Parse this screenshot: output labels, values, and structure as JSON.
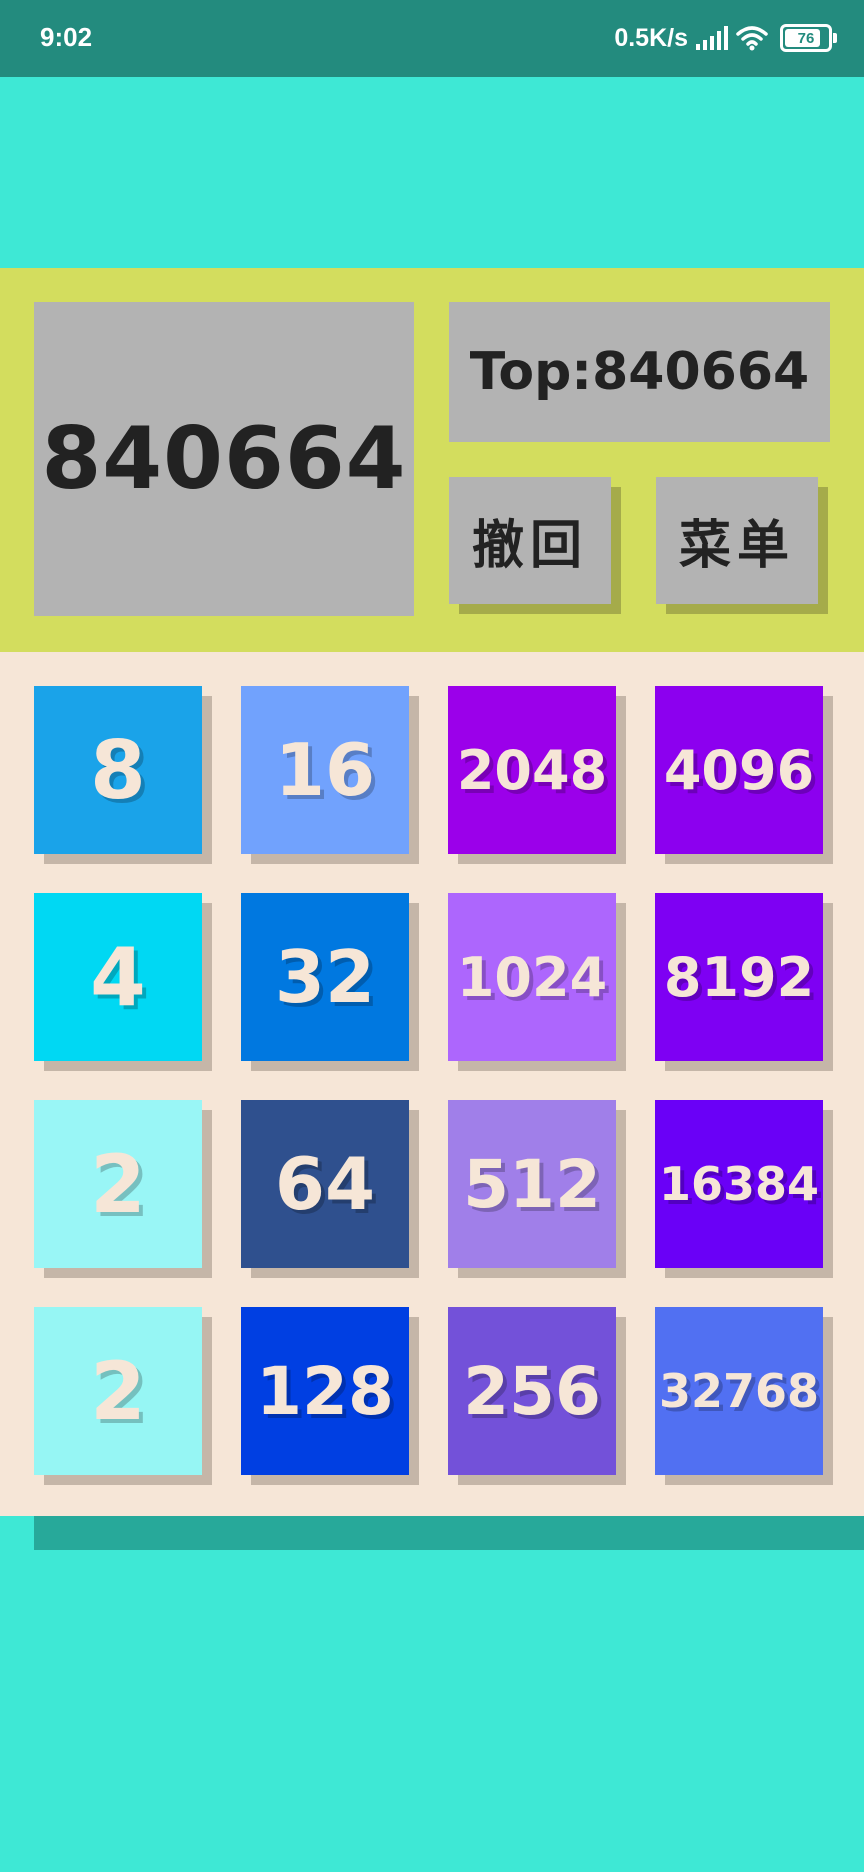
{
  "status_bar": {
    "time": "9:02",
    "net_speed": "0.5K/s",
    "battery_level": "76"
  },
  "header": {
    "score": "840664",
    "top": "Top:840664",
    "undo_label": "撤回",
    "menu_label": "菜单"
  },
  "board": {
    "tiles": [
      {
        "value": "8",
        "color": "#1aa3e9"
      },
      {
        "value": "16",
        "color": "#71a2fd"
      },
      {
        "value": "2048",
        "color": "#9b00ea"
      },
      {
        "value": "4096",
        "color": "#8c00ef"
      },
      {
        "value": "4",
        "color": "#00d8f3"
      },
      {
        "value": "32",
        "color": "#0078e0"
      },
      {
        "value": "1024",
        "color": "#ad66fd"
      },
      {
        "value": "8192",
        "color": "#7e00f3"
      },
      {
        "value": "2",
        "color": "#99f6f6"
      },
      {
        "value": "64",
        "color": "#2f508e"
      },
      {
        "value": "512",
        "color": "#a07fe9"
      },
      {
        "value": "16384",
        "color": "#6a00f7"
      },
      {
        "value": "2",
        "color": "#96f6f4"
      },
      {
        "value": "128",
        "color": "#003fe2"
      },
      {
        "value": "256",
        "color": "#7351d9"
      },
      {
        "value": "32768",
        "color": "#5170f2"
      }
    ]
  },
  "colors": {
    "background": "#3ee8d5",
    "status_bar": "#238b7e",
    "header_panel": "#d3dd5e",
    "board_background": "#f6e6d7",
    "box_gray": "#b3b3b3"
  }
}
